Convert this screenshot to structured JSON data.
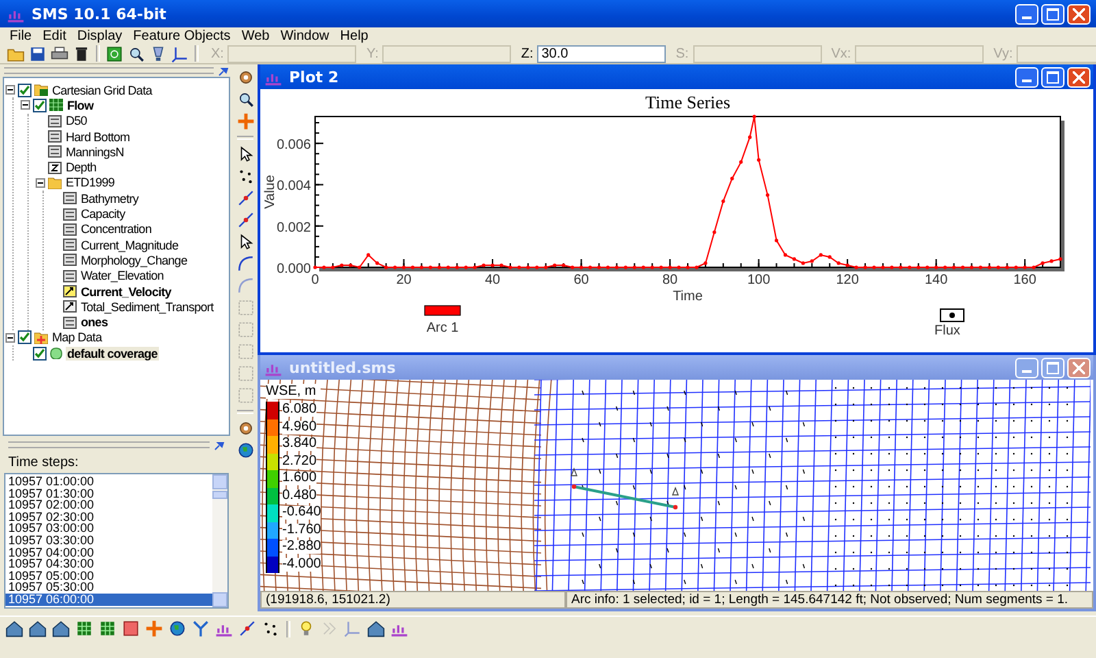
{
  "window": {
    "title": "SMS 10.1 64-bit"
  },
  "menu": [
    "File",
    "Edit",
    "Display",
    "Feature Objects",
    "Web",
    "Window",
    "Help"
  ],
  "coords": [
    {
      "label": "X:",
      "disabled": true
    },
    {
      "label": "Y:",
      "disabled": true
    },
    {
      "label": "Z:",
      "value": "30.0",
      "disabled": false
    },
    {
      "label": "S:",
      "disabled": true
    },
    {
      "label": "Vx:",
      "disabled": true
    },
    {
      "label": "Vy:",
      "disabled": true
    }
  ],
  "tree": [
    {
      "label": "Cartesian Grid Data",
      "kind": "grid-folder",
      "checked": true,
      "expanded": true,
      "active": false,
      "selected": false,
      "children": [
        {
          "label": "Flow",
          "kind": "grid",
          "checked": true,
          "expanded": true,
          "active": true,
          "selected": false,
          "children": [
            {
              "label": "D50",
              "kind": "scalar",
              "active": false,
              "selected": false
            },
            {
              "label": "Hard Bottom",
              "kind": "scalar",
              "active": false,
              "selected": false
            },
            {
              "label": "ManningsN",
              "kind": "scalar",
              "active": false,
              "selected": false
            },
            {
              "label": "Depth",
              "kind": "depth",
              "active": false,
              "selected": false
            },
            {
              "label": "ETD1999",
              "kind": "folder",
              "expanded": true,
              "active": false,
              "selected": false,
              "children": [
                {
                  "label": "Bathymetry",
                  "kind": "scalar",
                  "active": false,
                  "selected": false
                },
                {
                  "label": "Capacity",
                  "kind": "scalar",
                  "active": false,
                  "selected": false
                },
                {
                  "label": "Concentration",
                  "kind": "scalar",
                  "active": false,
                  "selected": false
                },
                {
                  "label": "Current_Magnitude",
                  "kind": "scalar",
                  "active": false,
                  "selected": false
                },
                {
                  "label": "Morphology_Change",
                  "kind": "scalar",
                  "active": false,
                  "selected": false
                },
                {
                  "label": "Water_Elevation",
                  "kind": "scalar",
                  "active": false,
                  "selected": false
                },
                {
                  "label": "Current_Velocity",
                  "kind": "vector",
                  "active": true,
                  "selected": false
                },
                {
                  "label": "Total_Sediment_Transport",
                  "kind": "vector",
                  "active": false,
                  "selected": false
                },
                {
                  "label": "ones",
                  "kind": "scalar",
                  "active": true,
                  "selected": false
                }
              ]
            }
          ]
        }
      ]
    },
    {
      "label": "Map Data",
      "kind": "map-folder",
      "checked": true,
      "expanded": true,
      "active": false,
      "selected": false,
      "children": [
        {
          "label": "default coverage",
          "kind": "coverage",
          "checked": true,
          "active": true,
          "selected": true
        }
      ]
    }
  ],
  "time_steps": {
    "label": "Time steps:",
    "items": [
      {
        "label": "10957 01:00:00",
        "selected": false
      },
      {
        "label": "10957 01:30:00",
        "selected": false
      },
      {
        "label": "10957 02:00:00",
        "selected": false
      },
      {
        "label": "10957 02:30:00",
        "selected": false
      },
      {
        "label": "10957 03:00:00",
        "selected": false
      },
      {
        "label": "10957 03:30:00",
        "selected": false
      },
      {
        "label": "10957 04:00:00",
        "selected": false
      },
      {
        "label": "10957 04:30:00",
        "selected": false
      },
      {
        "label": "10957 05:00:00",
        "selected": false
      },
      {
        "label": "10957 05:30:00",
        "selected": false
      },
      {
        "label": "10957 06:00:00",
        "selected": true
      }
    ]
  },
  "plot_window": {
    "title": "Plot 2",
    "active": true,
    "marker_legend": "Flux",
    "chart_data": {
      "type": "line",
      "title": "Time Series",
      "xlabel": "Time",
      "ylabel": "Value",
      "x": [
        0,
        2,
        4,
        6,
        8,
        10,
        12,
        14,
        16,
        18,
        20,
        22,
        24,
        26,
        28,
        30,
        32,
        34,
        36,
        38,
        40,
        42,
        44,
        46,
        48,
        50,
        52,
        54,
        56,
        58,
        60,
        62,
        64,
        66,
        68,
        70,
        72,
        74,
        76,
        78,
        80,
        82,
        84,
        86,
        88,
        90,
        92,
        94,
        96,
        98,
        99,
        100,
        102,
        104,
        106,
        108,
        110,
        112,
        114,
        116,
        118,
        120,
        122,
        124,
        126,
        128,
        130,
        132,
        134,
        136,
        138,
        140,
        142,
        144,
        146,
        148,
        150,
        152,
        154,
        156,
        158,
        160,
        162,
        164,
        166,
        168
      ],
      "series": [
        {
          "name": "Arc 1",
          "color": "#ff0000",
          "values": [
            0,
            0,
            0,
            0.0001,
            0.0001,
            0,
            0.0006,
            0.0002,
            0,
            0,
            0,
            0,
            0,
            0,
            0,
            0,
            0,
            0,
            0,
            0.0001,
            0.0001,
            0.0001,
            0,
            0,
            0,
            0,
            0,
            0.0001,
            0.0001,
            0,
            0,
            0,
            0,
            0,
            0,
            0,
            0,
            0,
            0,
            0,
            0,
            0,
            0,
            0,
            0.0002,
            0.0017,
            0.0032,
            0.0043,
            0.0051,
            0.0063,
            0.0073,
            0.0052,
            0.0035,
            0.0013,
            0.0006,
            0.0004,
            0.0002,
            0.0003,
            0.0006,
            0.0005,
            0.0002,
            0.0001,
            0,
            0,
            0,
            0,
            0,
            0,
            0,
            0,
            0,
            0,
            0,
            0,
            0,
            0,
            0,
            0,
            0,
            0,
            0,
            0,
            0,
            0.0002,
            0.0003,
            0.0004
          ]
        }
      ],
      "xlim": [
        0,
        168
      ],
      "ylim": [
        0,
        0.0073
      ],
      "xticks": [
        0,
        20,
        40,
        60,
        80,
        100,
        120,
        140,
        160
      ],
      "yticks": [
        {
          "value": 0,
          "label": "0.000"
        },
        {
          "value": 0.002,
          "label": "0.002"
        },
        {
          "value": 0.004,
          "label": "0.004"
        },
        {
          "value": 0.006,
          "label": "0.006"
        }
      ]
    }
  },
  "map_window": {
    "title": "untitled.sms",
    "active": false,
    "legend": {
      "title": "WSE, m",
      "entries": [
        {
          "label": "6.080",
          "color": "#d00000"
        },
        {
          "label": "4.960",
          "color": "#ff7000"
        },
        {
          "label": "3.840",
          "color": "#ffb000"
        },
        {
          "label": "2.720",
          "color": "#c8e000"
        },
        {
          "label": "1.600",
          "color": "#40d000"
        },
        {
          "label": "0.480",
          "color": "#00c040"
        },
        {
          "label": "-0.640",
          "color": "#00e0c0"
        },
        {
          "label": "-1.760",
          "color": "#20a8ff"
        },
        {
          "label": "-2.880",
          "color": "#0050ff"
        },
        {
          "label": "-4.000",
          "color": "#0000c0"
        }
      ]
    },
    "status": {
      "coordinates": "(191918.6, 151021.2)",
      "info": "Arc info: 1 selected; id = 1; Length = 145.647142 ft; Not observed; Num segments = 1."
    }
  }
}
